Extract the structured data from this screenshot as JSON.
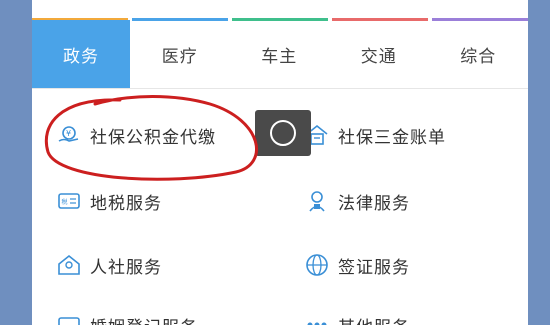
{
  "tabs": [
    {
      "label": "政务"
    },
    {
      "label": "医疗"
    },
    {
      "label": "车主"
    },
    {
      "label": "交通"
    },
    {
      "label": "综合"
    }
  ],
  "tab_strip_colors": [
    "#f2a93b",
    "#4aa3e8",
    "#3fbf8c",
    "#e86a6a",
    "#9b7fd9"
  ],
  "active_tab": "政务",
  "services": [
    {
      "label": "社保公积金代缴",
      "icon": "hand-coin-icon"
    },
    {
      "label": "社保三金账单",
      "icon": "house-bill-icon"
    },
    {
      "label": "地税服务",
      "icon": "tax-card-icon"
    },
    {
      "label": "法律服务",
      "icon": "law-person-icon"
    },
    {
      "label": "人社服务",
      "icon": "people-house-icon"
    },
    {
      "label": "签证服务",
      "icon": "globe-icon"
    },
    {
      "label": "婚姻登记服务",
      "icon": "marriage-card-icon"
    },
    {
      "label": "其他服务",
      "icon": "more-dots-icon"
    }
  ],
  "colors": {
    "accent": "#4aa3e8",
    "icon": "#3a8fd6",
    "annotation": "#cc1f1f"
  }
}
